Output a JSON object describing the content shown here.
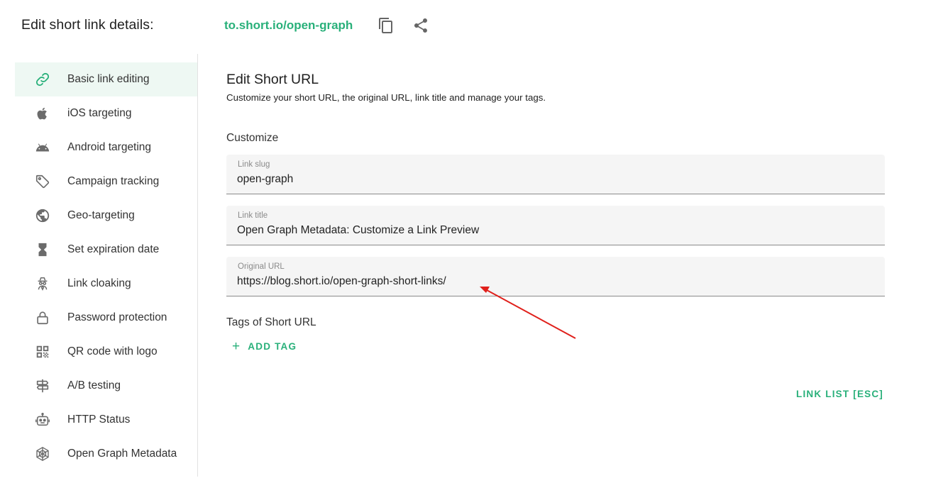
{
  "header": {
    "title": "Edit short link details:",
    "short_link": "to.short.io/open-graph",
    "icons": [
      "copy-icon",
      "share-icon"
    ]
  },
  "sidebar": {
    "items": [
      {
        "label": "Basic link editing",
        "icon": "link-icon",
        "active": true
      },
      {
        "label": "iOS targeting",
        "icon": "apple-icon"
      },
      {
        "label": "Android targeting",
        "icon": "android-icon"
      },
      {
        "label": "Campaign tracking",
        "icon": "tag-icon"
      },
      {
        "label": "Geo-targeting",
        "icon": "globe-icon"
      },
      {
        "label": "Set expiration date",
        "icon": "hourglass-icon"
      },
      {
        "label": "Link cloaking",
        "icon": "spy-icon"
      },
      {
        "label": "Password protection",
        "icon": "lock-icon"
      },
      {
        "label": "QR code with logo",
        "icon": "qr-code-icon"
      },
      {
        "label": "A/B testing",
        "icon": "signpost-icon"
      },
      {
        "label": "HTTP Status",
        "icon": "robot-icon"
      },
      {
        "label": "Open Graph Metadata",
        "icon": "web-icon"
      }
    ]
  },
  "main": {
    "title": "Edit Short URL",
    "subtitle": "Customize your short URL, the original URL, link title and manage your tags.",
    "customize_label": "Customize",
    "fields": {
      "slug": {
        "label": "Link slug",
        "value": "open-graph"
      },
      "title": {
        "label": "Link title",
        "value": "Open Graph Metadata: Customize a Link Preview"
      },
      "original_url": {
        "label": "Original URL",
        "value": "https://blog.short.io/open-graph-short-links/"
      }
    },
    "tags_label": "Tags of Short URL",
    "add_tag_label": "ADD TAG",
    "link_list_label": "LINK LIST [ESC]"
  },
  "colors": {
    "accent": "#29b07a",
    "active_bg": "#eef8f3",
    "annotation_arrow": "#e0201b"
  }
}
